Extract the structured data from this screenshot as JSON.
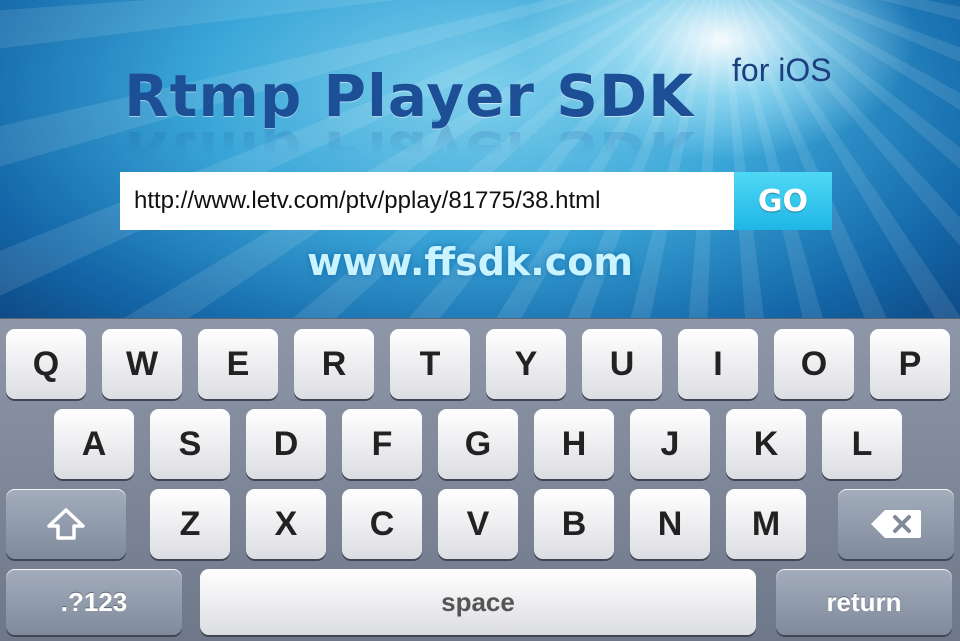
{
  "header": {
    "title": "Rtmp Player SDK",
    "subtitle": "for iOS",
    "website": "www.ffsdk.com"
  },
  "url_bar": {
    "value": "http://www.letv.com/ptv/pplay/81775/38.html",
    "go_label": "GO"
  },
  "keyboard": {
    "row1": [
      "Q",
      "W",
      "E",
      "R",
      "T",
      "Y",
      "U",
      "I",
      "O",
      "P"
    ],
    "row2": [
      "A",
      "S",
      "D",
      "F",
      "G",
      "H",
      "J",
      "K",
      "L"
    ],
    "row3": [
      "Z",
      "X",
      "C",
      "V",
      "B",
      "N",
      "M"
    ],
    "shift_icon": "shift-arrow-icon",
    "backspace_icon": "backspace-icon",
    "numbers_label": ".?123",
    "space_label": "space",
    "return_label": "return"
  }
}
